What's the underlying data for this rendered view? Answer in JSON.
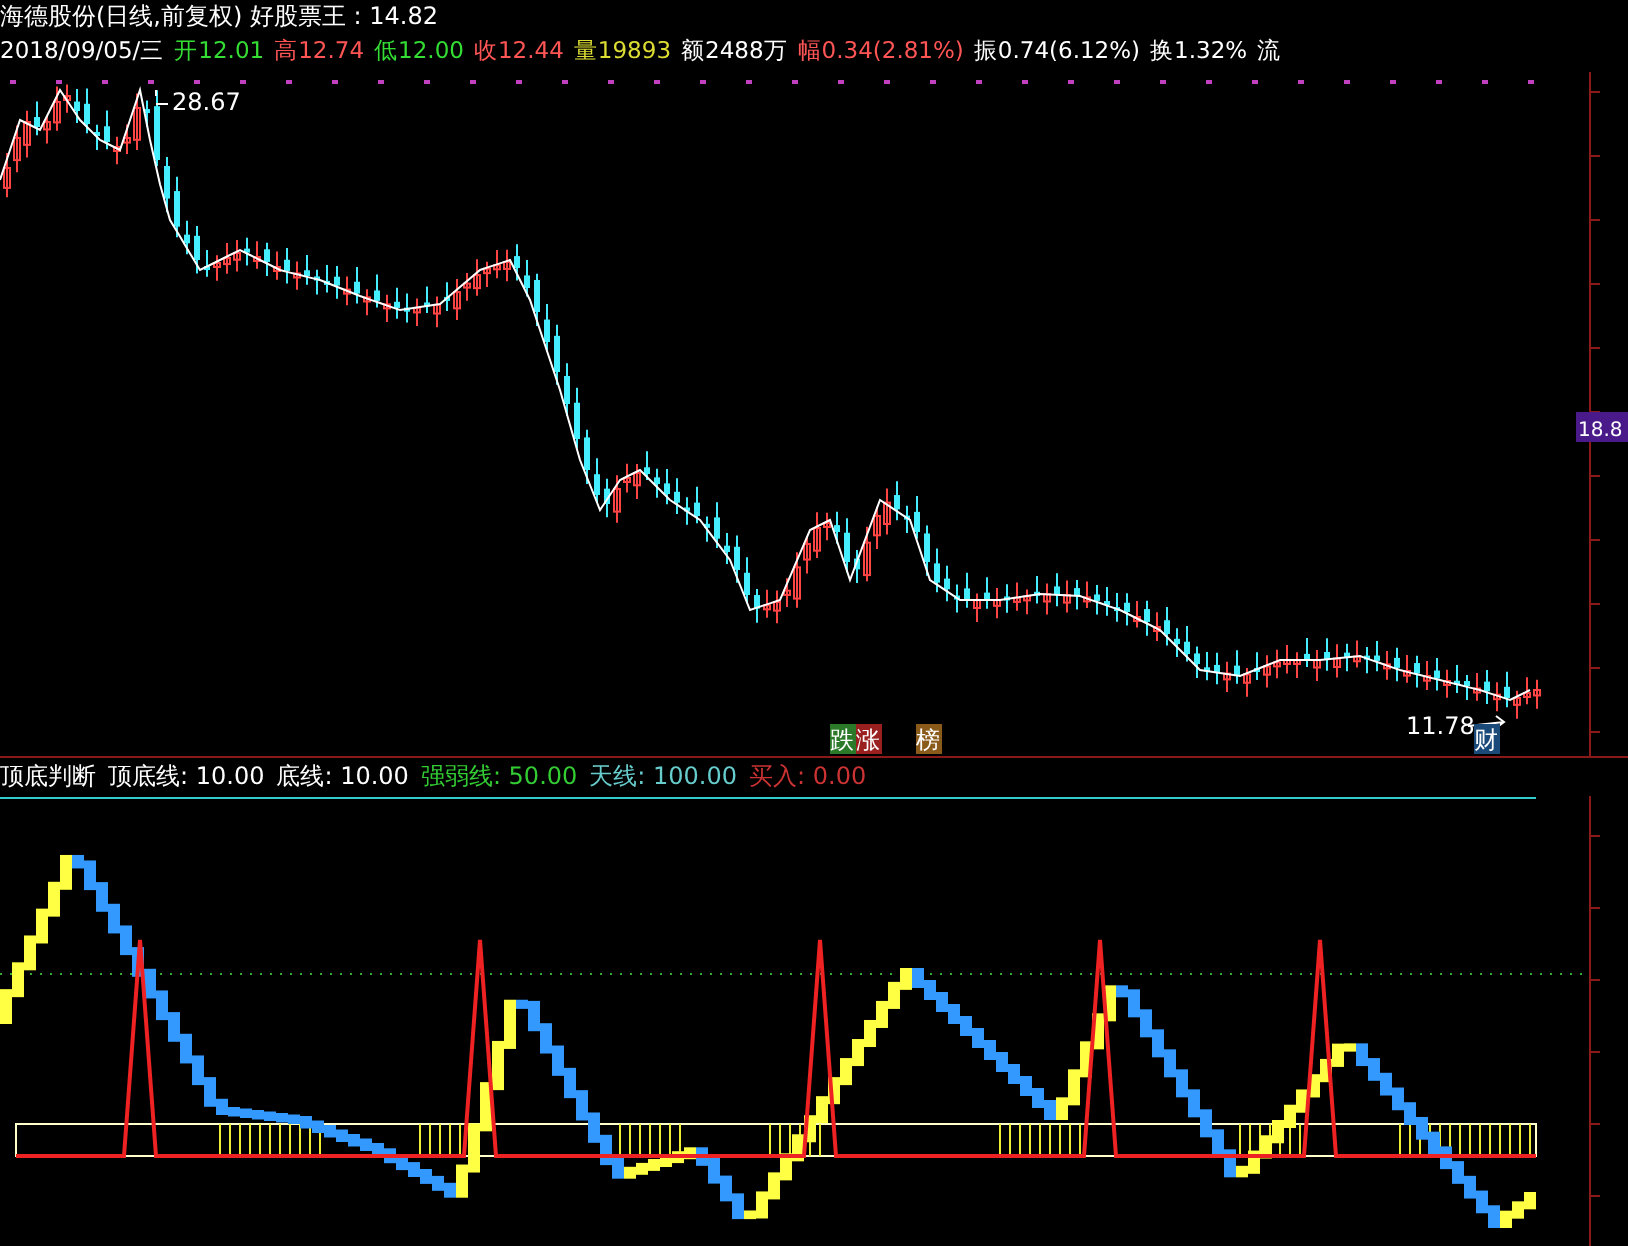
{
  "title": "海德股份(日线,前复权) 好股票王 : 14.82",
  "quote_bar": [
    {
      "text": "2018/09/05/三",
      "color": "#ffffff"
    },
    {
      "text": "开12.01",
      "color": "#33dd33"
    },
    {
      "text": "高12.74",
      "color": "#ff5555"
    },
    {
      "text": "低12.00",
      "color": "#33dd33"
    },
    {
      "text": "收12.44",
      "color": "#ff5555"
    },
    {
      "text": "量19893",
      "color": "#dddd33"
    },
    {
      "text": "额2488万",
      "color": "#ffffff"
    },
    {
      "text": "幅0.34(2.81%)",
      "color": "#ff5555"
    },
    {
      "text": "振0.74(6.12%)",
      "color": "#ffffff"
    },
    {
      "text": "换1.32%",
      "color": "#ffffff"
    },
    {
      "text": "流",
      "color": "#ffffff"
    }
  ],
  "price_chart": {
    "high_label": "28.67",
    "low_label": "11.78",
    "price_tag": "18.8",
    "badges": [
      {
        "text": "跌",
        "color": "#2a7a2a"
      },
      {
        "text": "涨",
        "color": "#9a2020"
      },
      {
        "text": "榜",
        "color": "#8a5a1a"
      },
      {
        "text": "财",
        "color": "#1a4a7a"
      }
    ]
  },
  "indicator_legend": [
    {
      "text": "顶底判断",
      "kind": "name"
    },
    {
      "text": "顶底线: 10.00",
      "kind": "plain"
    },
    {
      "text": "底线: 10.00",
      "kind": "plain"
    },
    {
      "text": "强弱线: 50.00",
      "kind": "strength"
    },
    {
      "text": "天线: 100.00",
      "kind": "sky"
    },
    {
      "text": "买入: 0.00",
      "kind": "buy"
    }
  ]
}
